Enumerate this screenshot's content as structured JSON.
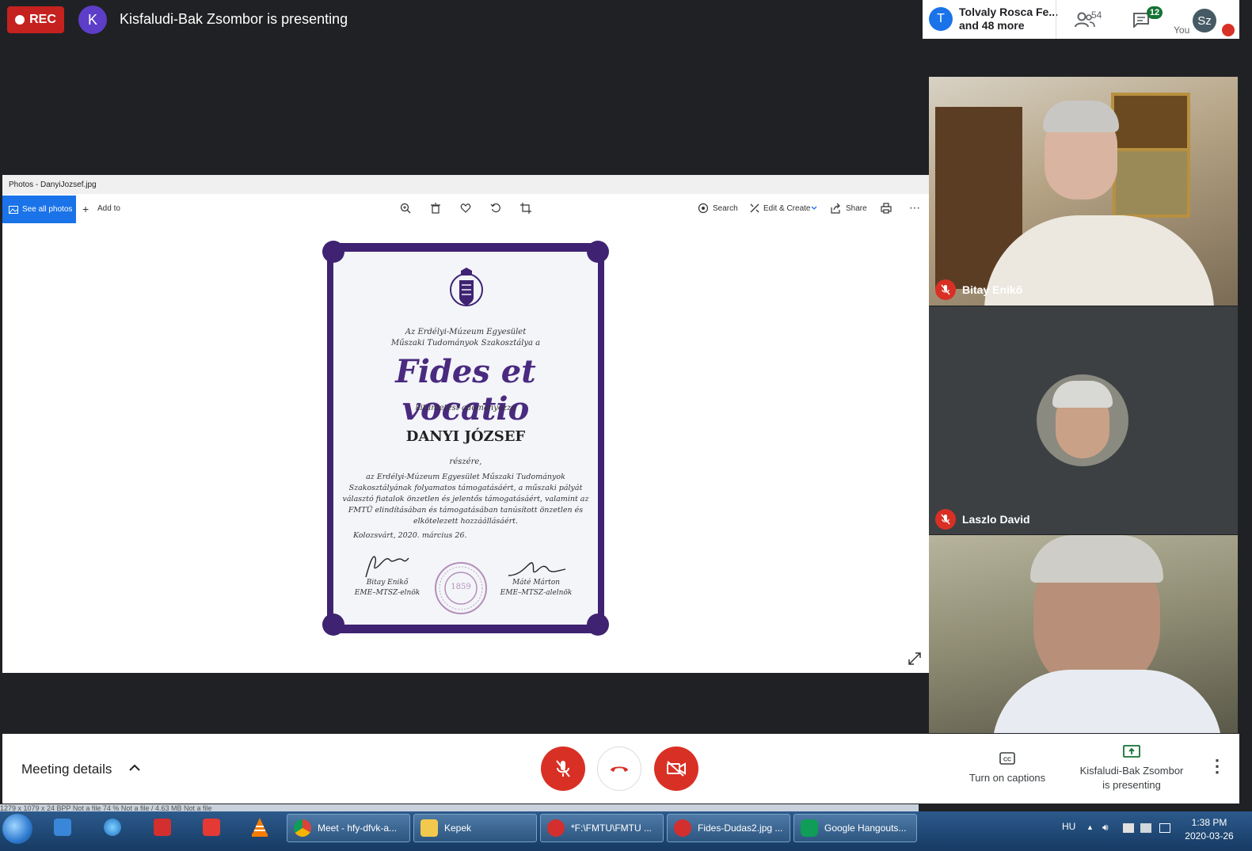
{
  "top_bar": {
    "rec_label": "REC",
    "presenter_initial": "K",
    "presenting_text": "Kisfaludi-Bak Zsombor is presenting"
  },
  "participants_header": {
    "avatar_initial": "T",
    "name_line1": "Tolvaly Rosca Fe...",
    "name_line2": "and 48 more",
    "people_count": "54",
    "chat_count": "12",
    "you_label": "You",
    "self_initials": "Sz"
  },
  "photos_app": {
    "title": "Photos - DanyiJozsef.jpg",
    "see_all_label": "See all photos",
    "add_to_label": "Add to",
    "search_label": "Search",
    "edit_label": "Edit & Create",
    "share_label": "Share"
  },
  "certificate": {
    "line1": "Az Erdélyi-Múzeum Egyesület",
    "line2": "Műszaki Tudományok Szakosztálya a",
    "award": "Fides et vocatio",
    "subtitle": "kitüntetést adományozza",
    "recipient": "DANYI JÓZSEF",
    "for_label": "részére,",
    "body1": "az Erdélyi-Múzeum Egyesület Műszaki Tudományok",
    "body2": "Szakosztályának folyamatos támogatásáért, a műszaki pályát",
    "body3": "választó fiatalok önzetlen és jelentős támogatásáért, valamint az",
    "body4": "FMTÜ elindításában és támogatásában tanúsított önzetlen és",
    "body5": "elkötelezett hozzáállásáért.",
    "place_date": "Kolozsvárt, 2020. március 26.",
    "sign1_name": "Bitay Enikő",
    "sign1_title": "EME–MTSZ-elnök",
    "seal_year": "1859",
    "sign2_name": "Máté Márton",
    "sign2_title": "EME–MTSZ-alelnök"
  },
  "tiles": [
    {
      "name": "Bitay Enikő"
    },
    {
      "name": "Laszlo David"
    },
    {
      "name": ""
    }
  ],
  "bottom_bar": {
    "meeting_details": "Meeting details",
    "captions_label": "Turn on captions",
    "presenting_line1": "Kisfaludi-Bak Zsombor",
    "presenting_line2": "is presenting"
  },
  "taskbar": {
    "status_strip": "1279 x 1079 x 24 BPP     Not a file     74 %     Not a file / 4.63 MB     Not a file",
    "buttons": [
      {
        "label": "Meet - hfy-dfvk-a..."
      },
      {
        "label": "Kepek"
      },
      {
        "label": "*F:\\FMTU\\FMTU ..."
      },
      {
        "label": "Fides-Dudas2.jpg ..."
      },
      {
        "label": "Google Hangouts..."
      }
    ],
    "language": "HU",
    "time": "1:38 PM",
    "date": "2020-03-26"
  },
  "colors": {
    "rec_red": "#c5221f",
    "mute_red": "#d93025",
    "certificate_purple": "#3f2372",
    "meet_dark": "#202124"
  }
}
